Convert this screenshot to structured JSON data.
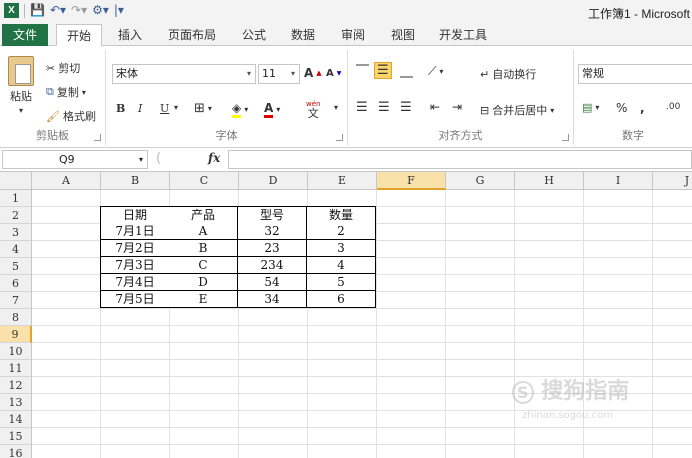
{
  "titlebar": {
    "app_icon": "X",
    "title": "工作簿1 - Microsoft"
  },
  "tabs": {
    "file": "文件",
    "home": "开始",
    "insert": "插入",
    "page_layout": "页面布局",
    "formulas": "公式",
    "data": "数据",
    "review": "审阅",
    "view": "视图",
    "developer": "开发工具"
  },
  "clipboard": {
    "paste": "粘贴",
    "cut": "剪切",
    "copy": "复制",
    "format_painter": "格式刷",
    "label": "剪贴板"
  },
  "font": {
    "name": "宋体",
    "size": "11",
    "grow": "A",
    "shrink": "A",
    "bold": "B",
    "italic": "I",
    "underline": "U",
    "label": "字体",
    "phonetic": "wén"
  },
  "alignment": {
    "wrap_text": "自动换行",
    "merge_center": "合并后居中",
    "label": "对齐方式"
  },
  "number": {
    "format": "常规",
    "percent": "%",
    "comma": ",",
    "label": "数字"
  },
  "formula_bar": {
    "name_box": "Q9",
    "fx": "fx",
    "value": ""
  },
  "sheet": {
    "columns": [
      "A",
      "B",
      "C",
      "D",
      "E",
      "F",
      "G",
      "H",
      "I",
      "J"
    ],
    "selected_column": "F",
    "rows": [
      "1",
      "2",
      "3",
      "4",
      "5",
      "6",
      "7",
      "8",
      "9",
      "10",
      "11",
      "12",
      "13",
      "14",
      "15",
      "16"
    ],
    "selected_row": "9",
    "table": {
      "headers": [
        "日期",
        "产品",
        "型号",
        "数量"
      ],
      "rows": [
        [
          "7月1日",
          "A",
          "32",
          "2"
        ],
        [
          "7月2日",
          "B",
          "23",
          "3"
        ],
        [
          "7月3日",
          "C",
          "234",
          "4"
        ],
        [
          "7月4日",
          "D",
          "54",
          "5"
        ],
        [
          "7月5日",
          "E",
          "34",
          "6"
        ]
      ]
    }
  },
  "watermark": {
    "text": "搜狗指南",
    "sub": "zhinan.sogou.com"
  },
  "colors": {
    "file_tab": "#217346",
    "selection_header": "#f9e1a9",
    "selection_accent": "#e2a42a"
  }
}
